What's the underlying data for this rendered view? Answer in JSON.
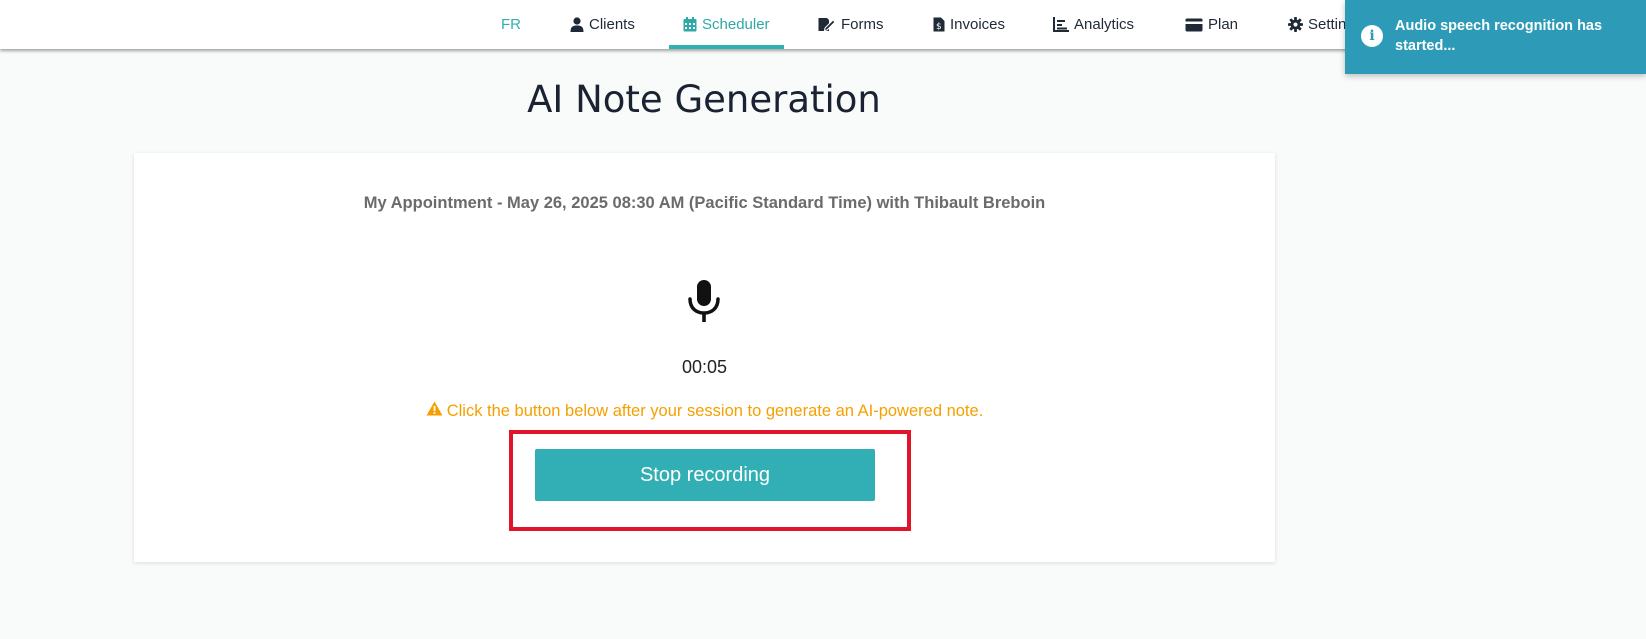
{
  "nav": {
    "lang": "FR",
    "items": [
      {
        "label": "Clients",
        "icon": "user-icon"
      },
      {
        "label": "Scheduler",
        "icon": "calendar-icon",
        "active": true
      },
      {
        "label": "Forms",
        "icon": "form-edit-icon"
      },
      {
        "label": "Invoices",
        "icon": "invoice-icon"
      },
      {
        "label": "Analytics",
        "icon": "chart-icon"
      },
      {
        "label": "Plan",
        "icon": "credit-card-icon"
      },
      {
        "label": "Settin",
        "icon": "gear-icon"
      }
    ]
  },
  "toast": {
    "message": "Audio speech recognition has started...",
    "icon": "info-icon",
    "color": "#2d9bb7"
  },
  "page": {
    "title": "AI Note Generation"
  },
  "card": {
    "appointment": "My Appointment - May 26, 2025 08:30 AM (Pacific Standard Time) with Thibault Breboin",
    "timer": "00:05",
    "warning": "Click the button below after your session to generate an AI-powered note.",
    "stop_label": "Stop recording"
  },
  "colors": {
    "accent": "#31afb4",
    "warning": "#f5a000",
    "highlight": "#e0142a"
  }
}
